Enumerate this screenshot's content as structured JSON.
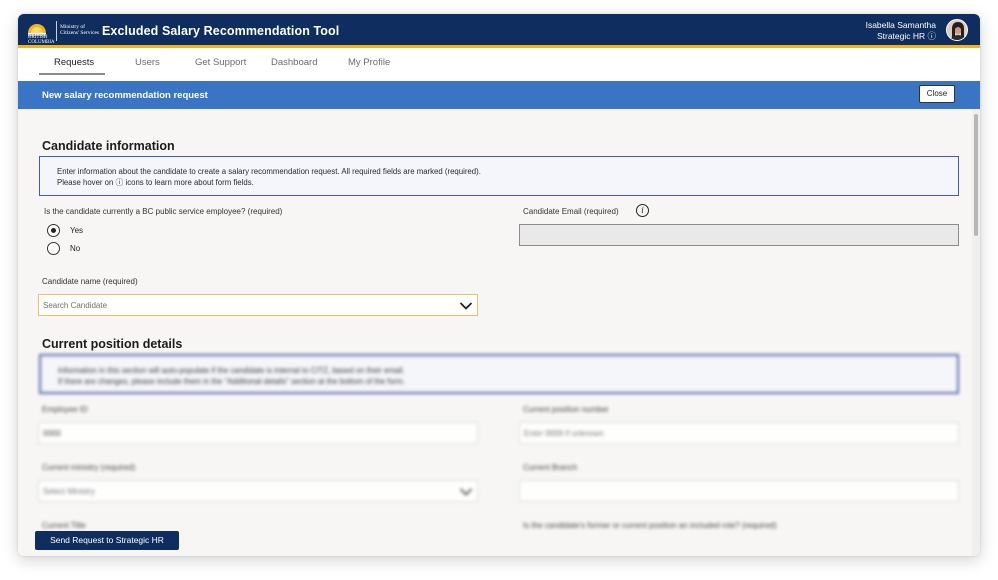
{
  "header": {
    "logo_line1": "BRITISH COLUMBIA",
    "logo_line2": "Ministry of Citizens' Services",
    "app_title": "Excluded Salary Recommendation Tool",
    "user_name": "Isabella Samantha",
    "user_role": "Strategic HR ⓘ"
  },
  "nav": {
    "items": [
      {
        "label": "Requests",
        "active": true
      },
      {
        "label": "Users"
      },
      {
        "label": "Get Support"
      },
      {
        "label": "Dashboard"
      },
      {
        "label": "My Profile"
      }
    ]
  },
  "banner": {
    "title": "New salary recommendation request",
    "close_label": "Close"
  },
  "candidate": {
    "section_title": "Candidate information",
    "info_line1": "Enter information about the candidate to create a salary recommendation request. All required fields are marked (required).",
    "info_line2": "Please hover on ⓘ icons to learn more about form fields.",
    "employee_question": "Is the candidate currently a BC public service employee? (required)",
    "yes_label": "Yes",
    "no_label": "No",
    "email_label": "Candidate Email (required)",
    "info_icon": "i",
    "name_label": "Candidate name (required)",
    "name_placeholder": "Search Candidate"
  },
  "position": {
    "section_title": "Current position details",
    "info_line1": "Information in this section will auto-populate if the candidate is internal to CITZ, based on their email.",
    "info_line2": "If there are changes, please include them in the \"Additional details\" section at the bottom of the form.",
    "employee_id_label": "Employee ID",
    "employee_id_value": "0000",
    "position_number_label": "Current position number",
    "position_number_placeholder": "Enter 9999 if unknown",
    "ministry_label": "Current ministry (required)",
    "ministry_placeholder": "Select Ministry",
    "branch_label": "Current Branch",
    "title_label": "Current Title",
    "included_role_label": "Is the candidate's former or current position an included role? (required)"
  },
  "footer": {
    "send_label": "Send Request to Strategic HR"
  },
  "colors": {
    "header_bg": "#0f2e5f",
    "accent_gold": "#f6b21a",
    "banner_blue": "#3a74c4"
  }
}
